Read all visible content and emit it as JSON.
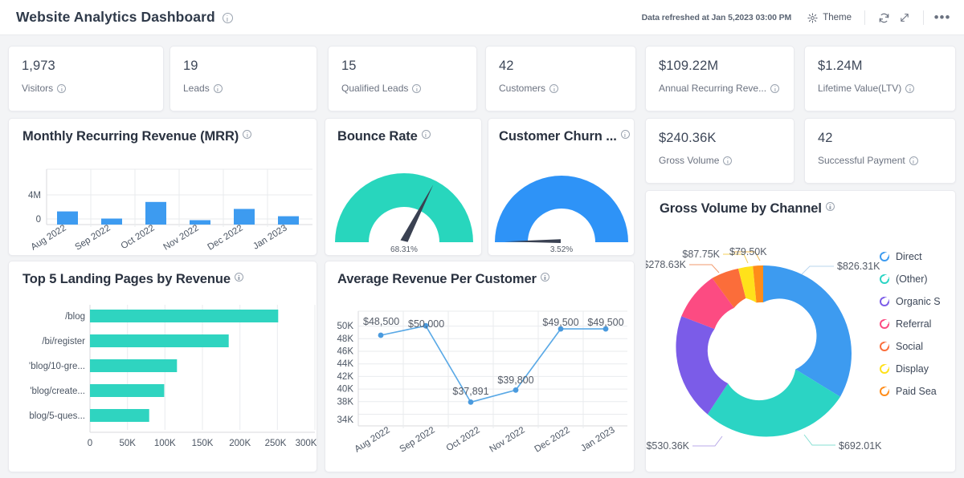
{
  "header": {
    "title": "Website Analytics Dashboard",
    "refreshed": "Data refreshed at Jan 5,2023 03:00 PM",
    "theme_label": "Theme",
    "theme_icon": "sun-icon",
    "refresh_icon": "refresh-icon",
    "expand_icon": "expand-icon",
    "more_icon": "more-icon",
    "info_icon": "info-icon"
  },
  "kpis_row1": [
    {
      "value": "1,973",
      "label": "Visitors"
    },
    {
      "value": "19",
      "label": "Leads"
    },
    {
      "value": "15",
      "label": "Qualified Leads"
    },
    {
      "value": "42",
      "label": "Customers"
    },
    {
      "value": "$109.22M",
      "label": "Annual Recurring Reve..."
    },
    {
      "value": "$1.24M",
      "label": "Lifetime Value(LTV)"
    }
  ],
  "kpis_row2": [
    {
      "value": "$240.36K",
      "label": "Gross Volume"
    },
    {
      "value": "42",
      "label": "Successful Payment"
    }
  ],
  "mrr": {
    "title": "Monthly Recurring Revenue (MRR)"
  },
  "bounce": {
    "title": "Bounce Rate",
    "value": "68.31%"
  },
  "churn": {
    "title": "Customer Churn ...",
    "value": "3.52%"
  },
  "landing": {
    "title": "Top 5 Landing Pages by Revenue"
  },
  "arpc": {
    "title": "Average Revenue Per Customer"
  },
  "donut": {
    "title": "Gross Volume by Channel"
  },
  "chart_data": [
    {
      "type": "bar",
      "title": "Monthly Recurring Revenue (MRR)",
      "categories": [
        "Aug 2022",
        "Sep 2022",
        "Oct 2022",
        "Nov 2022",
        "Dec 2022",
        "Jan 2023"
      ],
      "values": [
        1250000,
        600000,
        3750000,
        400000,
        1800000,
        850000
      ],
      "ytick_labels": [
        "4M",
        "0"
      ],
      "ytick_values": [
        4000000,
        0
      ],
      "ylim": [
        0,
        5600000
      ],
      "xlabel": "",
      "ylabel": "",
      "grid": true,
      "color": "#3d9bf0"
    },
    {
      "type": "gauge",
      "title": "Bounce Rate",
      "value": 68.31,
      "value_label": "68.31%",
      "min": 0,
      "max": 100,
      "color": "#28d6bd"
    },
    {
      "type": "gauge",
      "title": "Customer Churn ...",
      "value": 3.52,
      "value_label": "3.52%",
      "min": 0,
      "max": 100,
      "color": "#2e93f7"
    },
    {
      "type": "bar",
      "orientation": "horizontal",
      "title": "Top 5 Landing Pages by Revenue",
      "categories": [
        "/blog",
        "/bi/register",
        "'blog/10-gre...",
        "'blog/create...",
        "blog/5-ques..."
      ],
      "values": [
        251000,
        185000,
        116000,
        99000,
        79000
      ],
      "xtick_labels": [
        "0",
        "50K",
        "100K",
        "150K",
        "200K",
        "250K",
        "300K"
      ],
      "xtick_values": [
        0,
        50000,
        100000,
        150000,
        200000,
        250000,
        300000
      ],
      "xlim": [
        0,
        300000
      ],
      "grid": true,
      "color": "#2fd4c0"
    },
    {
      "type": "line",
      "title": "Average Revenue Per Customer",
      "x": [
        "Aug 2022",
        "Sep 2022",
        "Oct 2022",
        "Nov 2022",
        "Dec 2022",
        "Jan 2023"
      ],
      "values": [
        48500,
        50000,
        37891,
        39800,
        49500,
        49500
      ],
      "point_labels": [
        "$48,500",
        "$50,000",
        "$37,891",
        "$39,800",
        "$49,500",
        "$49,500"
      ],
      "ytick_labels": [
        "50K",
        "48K",
        "46K",
        "44K",
        "42K",
        "40K",
        "38K",
        "34K"
      ],
      "ytick_values": [
        50000,
        48000,
        46000,
        44000,
        42000,
        40000,
        38000,
        34000
      ],
      "ylim": [
        33000,
        51200
      ],
      "grid": true,
      "color": "#5aa9e6"
    },
    {
      "type": "pie",
      "subtype": "donut",
      "title": "Gross Volume by Channel",
      "labels": [
        "Direct",
        "(Other)",
        "Organic S",
        "Referral",
        "Social",
        "Display",
        "Paid Sea"
      ],
      "values": [
        826310,
        692010,
        530360,
        278630,
        87750,
        79500,
        0
      ],
      "value_labels": [
        "$826.31K",
        "$692.01K",
        "$530.36K",
        "$278.63K",
        "$87.75K",
        "$79.50K"
      ],
      "colors": [
        "#3d9bf0",
        "#2bd4c4",
        "#7b5ce8",
        "#fc4b82",
        "#fb6d3a",
        "#ffe11a",
        "#ff8c19"
      ],
      "legend_position": "right"
    }
  ]
}
